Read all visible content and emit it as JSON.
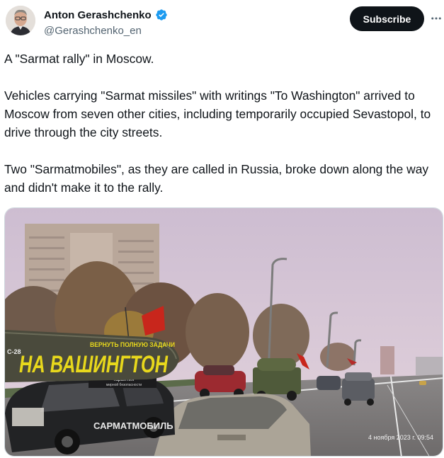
{
  "author": {
    "name": "Anton Gerashchenko",
    "handle": "@Gerashchenko_en",
    "verified_icon": "verified-badge-icon",
    "avatar_icon": "avatar-portrait"
  },
  "actions": {
    "subscribe_label": "Subscribe",
    "more_icon": "more-horizontal-icon"
  },
  "tweet": {
    "paragraphs": [
      "A \"Sarmat rally\" in Moscow.",
      "Vehicles carrying \"Sarmat missiles\" with writings \"To Washington\" arrived to Moscow from seven other cities, including temporarily occupied Sevastopol, to drive through the city streets.",
      "Two \"Sarmatmobiles\", as they are called in Russia, broke down along the way and didn't make it to the rally."
    ]
  },
  "media": {
    "missile_text": "НА ВАШИНГТОН",
    "missile_subtext": "ВЕРНУТЬ ПОЛНУЮ ЗАДАЧИ",
    "missile_model": "С-28",
    "car_door_text": "САРМАТМОБИЛЬ",
    "roof_sign_text": "гарантия",
    "roof_sign_subtext": "мирной безопасности",
    "timestamp": "4 ноября 2023 г. 09:54",
    "colors": {
      "sky": "#d9c9d8",
      "missile": "#4a4a3c",
      "missile_text": "#e8d81c",
      "flag": "#c8261c"
    }
  }
}
